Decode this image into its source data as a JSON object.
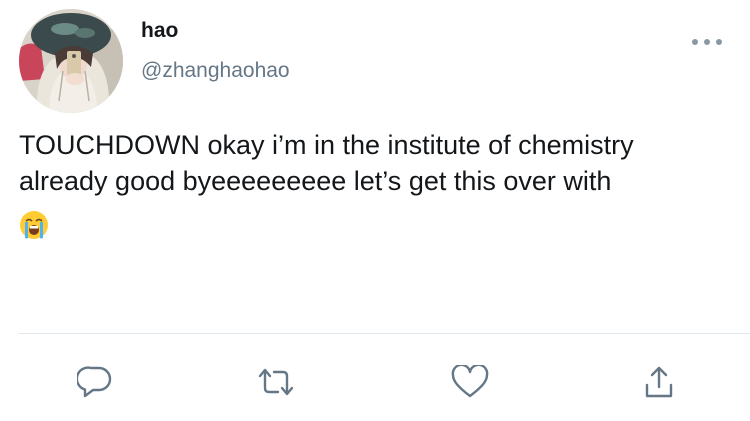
{
  "tweet": {
    "author_name": "hao",
    "author_handle": "@zhanghaohao",
    "text": "TOUCHDOWN okay i’m in the institute of chemistry\nalready good byeeeeeeeee let’s get this over with",
    "emoji": "😭",
    "emoji_icon": "loudly-crying-face-icon"
  },
  "actions": {
    "reply_icon": "reply-icon",
    "retweet_icon": "retweet-icon",
    "like_icon": "heart-icon",
    "share_icon": "share-icon",
    "more_icon": "more-options-icon"
  },
  "colors": {
    "text_primary": "#14171a",
    "text_secondary": "#657786",
    "icon": "#657786",
    "divider": "#e1e8ed"
  }
}
